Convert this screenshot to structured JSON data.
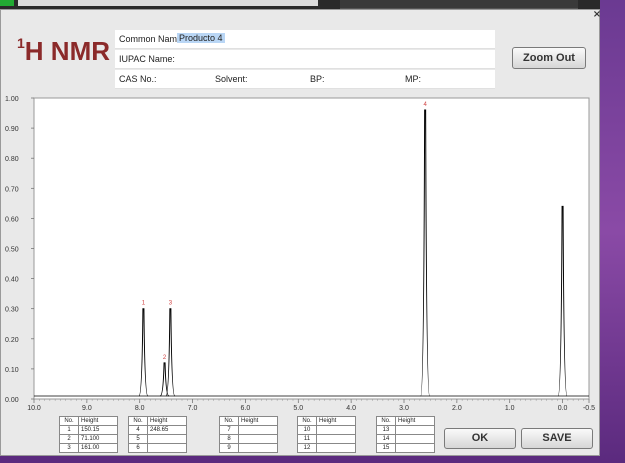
{
  "logo": {
    "sup": "1",
    "text": "H NMR"
  },
  "info": {
    "common_name_label": "Common Name:",
    "common_name_value": "Producto 4",
    "iupac_label": "IUPAC Name:",
    "cas_label": "CAS No.:",
    "solvent_label": "Solvent:",
    "bp_label": "BP:",
    "mp_label": "MP:"
  },
  "buttons": {
    "zoom_out": "Zoom Out",
    "ok": "OK",
    "save": "SAVE"
  },
  "close": "×",
  "peak_tables": [
    {
      "header_no": "No.",
      "header_h": "Height",
      "rows": [
        [
          "1",
          "150.15"
        ],
        [
          "2",
          "71.100"
        ],
        [
          "3",
          "161.00"
        ]
      ]
    },
    {
      "header_no": "No.",
      "header_h": "Height",
      "rows": [
        [
          "4",
          "248.65"
        ],
        [
          "5",
          ""
        ],
        [
          "6",
          ""
        ]
      ]
    },
    {
      "header_no": "No.",
      "header_h": "Height",
      "rows": [
        [
          "7",
          ""
        ],
        [
          "8",
          ""
        ],
        [
          "9",
          ""
        ]
      ]
    },
    {
      "header_no": "No.",
      "header_h": "Height",
      "rows": [
        [
          "10",
          ""
        ],
        [
          "11",
          ""
        ],
        [
          "12",
          ""
        ]
      ]
    },
    {
      "header_no": "No.",
      "header_h": "Height",
      "rows": [
        [
          "13",
          ""
        ],
        [
          "14",
          ""
        ],
        [
          "15",
          ""
        ]
      ]
    }
  ],
  "chart_data": {
    "type": "line",
    "xlim": [
      10.0,
      -0.5
    ],
    "ylim": [
      0.0,
      1.0
    ],
    "x_ticks": [
      "10.0",
      "9.0",
      "8.0",
      "7.0",
      "6.0",
      "5.0",
      "4.0",
      "3.0",
      "2.0",
      "1.0",
      "0.0",
      "-0.5"
    ],
    "x_tick_values": [
      10,
      9,
      8,
      7,
      6,
      5,
      4,
      3,
      2,
      1,
      0,
      -0.5
    ],
    "y_ticks": [
      "0.00",
      "0.10",
      "0.20",
      "0.30",
      "0.40",
      "0.50",
      "0.60",
      "0.70",
      "0.80",
      "0.90",
      "1.00"
    ],
    "peaks": [
      {
        "label": "1",
        "x": 7.93,
        "height": 0.3
      },
      {
        "label": "2",
        "x": 7.53,
        "height": 0.12
      },
      {
        "label": "3",
        "x": 7.42,
        "height": 0.3
      },
      {
        "label": "4",
        "x": 2.6,
        "height": 0.96
      },
      {
        "label": "",
        "x": 0.0,
        "height": 0.64
      }
    ],
    "grid": false,
    "line_color": "#000000",
    "peak_label_color": "#d04040"
  }
}
